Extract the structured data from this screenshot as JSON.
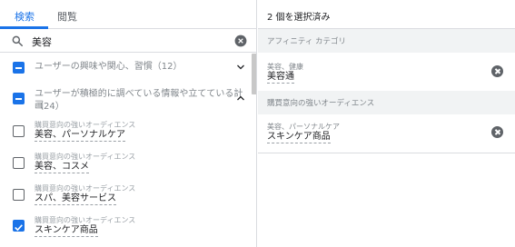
{
  "tabs": [
    {
      "label": "検索",
      "active": true
    },
    {
      "label": "閲覧",
      "active": false
    }
  ],
  "search": {
    "value": "美容"
  },
  "categories": [
    {
      "label": "ユーザーの興味や関心、習慣（12）",
      "state": "indeterminate",
      "expanded": false
    },
    {
      "label_line1": "ユーザーが積極的に調べている情報や立てている計画",
      "label_line2": "（24）",
      "state": "indeterminate",
      "expanded": true
    }
  ],
  "items": [
    {
      "sub": "購買意向の強いオーディエンス",
      "main": "美容、パーソナルケア",
      "checked": false
    },
    {
      "sub": "購買意向の強いオーディエンス",
      "main": "美容、コスメ",
      "checked": false
    },
    {
      "sub": "購買意向の強いオーディエンス",
      "main": "スパ、美容サービス",
      "checked": false
    },
    {
      "sub": "購買意向の強いオーディエンス",
      "main": "スキンケア商品",
      "checked": true
    }
  ],
  "selected": {
    "title": "2 個を選択済み",
    "groups": [
      {
        "header": "アフィニティ カテゴリ",
        "items": [
          {
            "sub": "美容、健康",
            "main": "美容通"
          }
        ]
      },
      {
        "header": "購買意向の強いオーディエンス",
        "items": [
          {
            "sub": "美容、パーソナルケア",
            "main": "スキンケア商品"
          }
        ]
      }
    ]
  },
  "colors": {
    "accent": "#1a73e8",
    "icon": "#5f6368",
    "section_bg": "#f1f3f4"
  }
}
